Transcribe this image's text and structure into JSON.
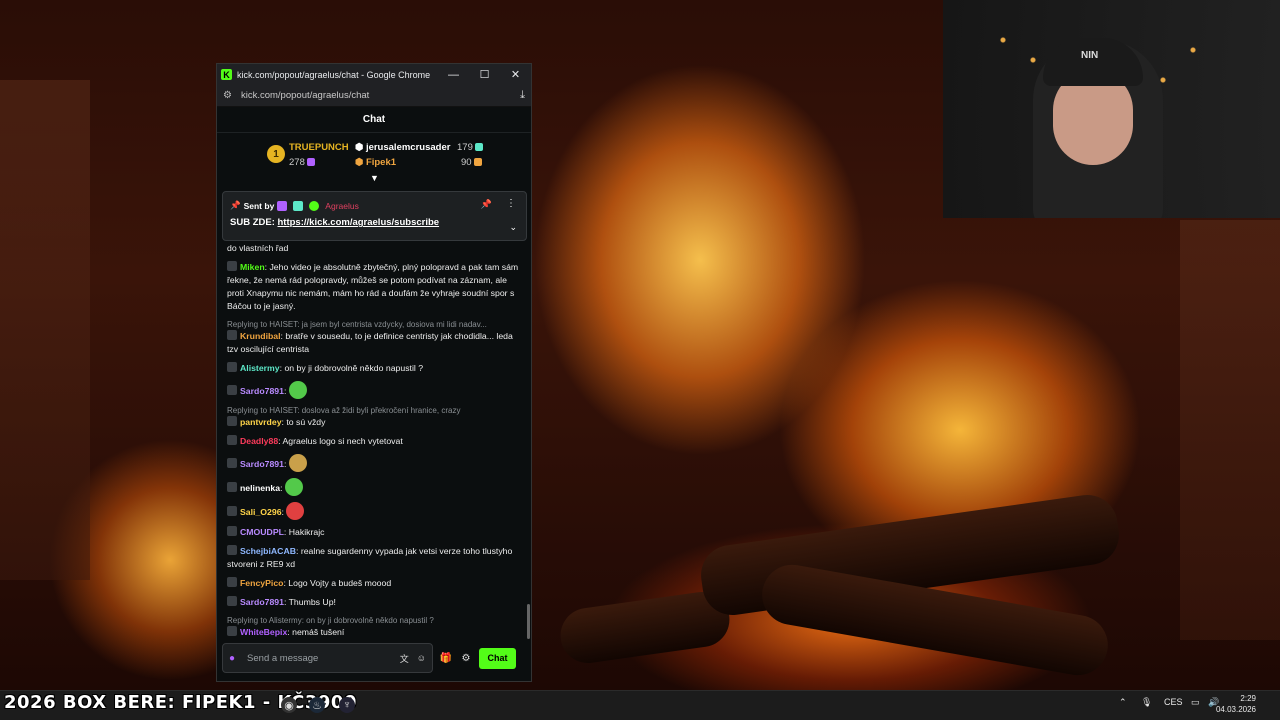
{
  "browser": {
    "window_title": "kick.com/popout/agraelus/chat - Google Chrome",
    "url": "kick.com/popout/agraelus/chat",
    "minimize": "—",
    "maximize": "☐",
    "close": "✕"
  },
  "chat": {
    "header": "Chat",
    "leaderboard": {
      "rank": "1",
      "first_name": "TRUEPUNCH",
      "first_count": "278",
      "second_name": "jerusalemcrusader",
      "second_count": "179",
      "third_name": "Fipek1",
      "third_count": "90"
    },
    "pinned": {
      "sent_by": "Sent by",
      "sender": "Agraelus",
      "text_prefix": "SUB ZDE: ",
      "link": "https://kick.com/agraelus/subscribe"
    },
    "messages": [
      {
        "reply": "",
        "user": "",
        "color": "#ffffff",
        "text": "do vlastních řad"
      },
      {
        "reply": "",
        "user": "Miken",
        "color": "#53fc18",
        "text": "Jeho video je absolutně zbytečný, plný polopravd a pak tam sám řekne, že nemá rád polopravdy, můžeš se potom podívat na záznam, ale proti Xnapymu nic nemám, mám ho rád a doufám že vyhraje soudní spor s Báčou to je jasný."
      },
      {
        "reply": "Replying to HAISET: ja jsem byl centrista vzdycky, dosiova mi lidi nadav...",
        "user": "Krundibal",
        "color": "#f0a540",
        "text": "bratře v sousedu, to je definice centristy jak chodidla... leda tzv oscilující centrista"
      },
      {
        "reply": "",
        "user": "Alistermy",
        "color": "#5de8c8",
        "text": "on by ji dobrovolně někdo napustil ?"
      },
      {
        "reply": "",
        "user": "Sardo7891",
        "color": "#b98bff",
        "text": ""
      },
      {
        "reply": "Replying to HAISET: doslova až židi byli překročení hranice, crazy",
        "user": "pantvrdey",
        "color": "#ffd54a",
        "text": "to sú vždy"
      },
      {
        "reply": "",
        "user": "Deadly88",
        "color": "#ff3b5c",
        "text": "Agraelus logo si nech vytetovat"
      },
      {
        "reply": "",
        "user": "Sardo7891",
        "color": "#b98bff",
        "text": ""
      },
      {
        "reply": "",
        "user": "nelinenka",
        "color": "#ffffff",
        "text": ""
      },
      {
        "reply": "",
        "user": "Sali_O296",
        "color": "#ffd54a",
        "text": ""
      },
      {
        "reply": "",
        "user": "CMOUDPL",
        "color": "#b98bff",
        "text": "Hakikrajc"
      },
      {
        "reply": "",
        "user": "SchejbiACAB",
        "color": "#8fb8ff",
        "text": "realne sugardenny vypada jak vetsi verze toho tlustyho stvoreni z RE9 xd"
      },
      {
        "reply": "",
        "user": "FencyPico",
        "color": "#f0a540",
        "text": "Logo Vojty a budeš moood"
      },
      {
        "reply": "",
        "user": "Sardo7891",
        "color": "#b98bff",
        "text": "Thumbs Up!"
      },
      {
        "reply": "Replying to Alistermy: on by ji dobrovolně někdo napustil ?",
        "user": "WhiteBepix",
        "color": "#b061ff",
        "text": "nemáš tušení"
      }
    ],
    "input_placeholder": "Send a message",
    "chat_button": "Chat"
  },
  "webcam": {
    "cap_text": "NIN"
  },
  "ticker": "2026 BOX BERE: FIPEK1 - KČ3900",
  "taskbar": {
    "lang": "CES",
    "time": "2:29",
    "date": "04.03.2026"
  }
}
